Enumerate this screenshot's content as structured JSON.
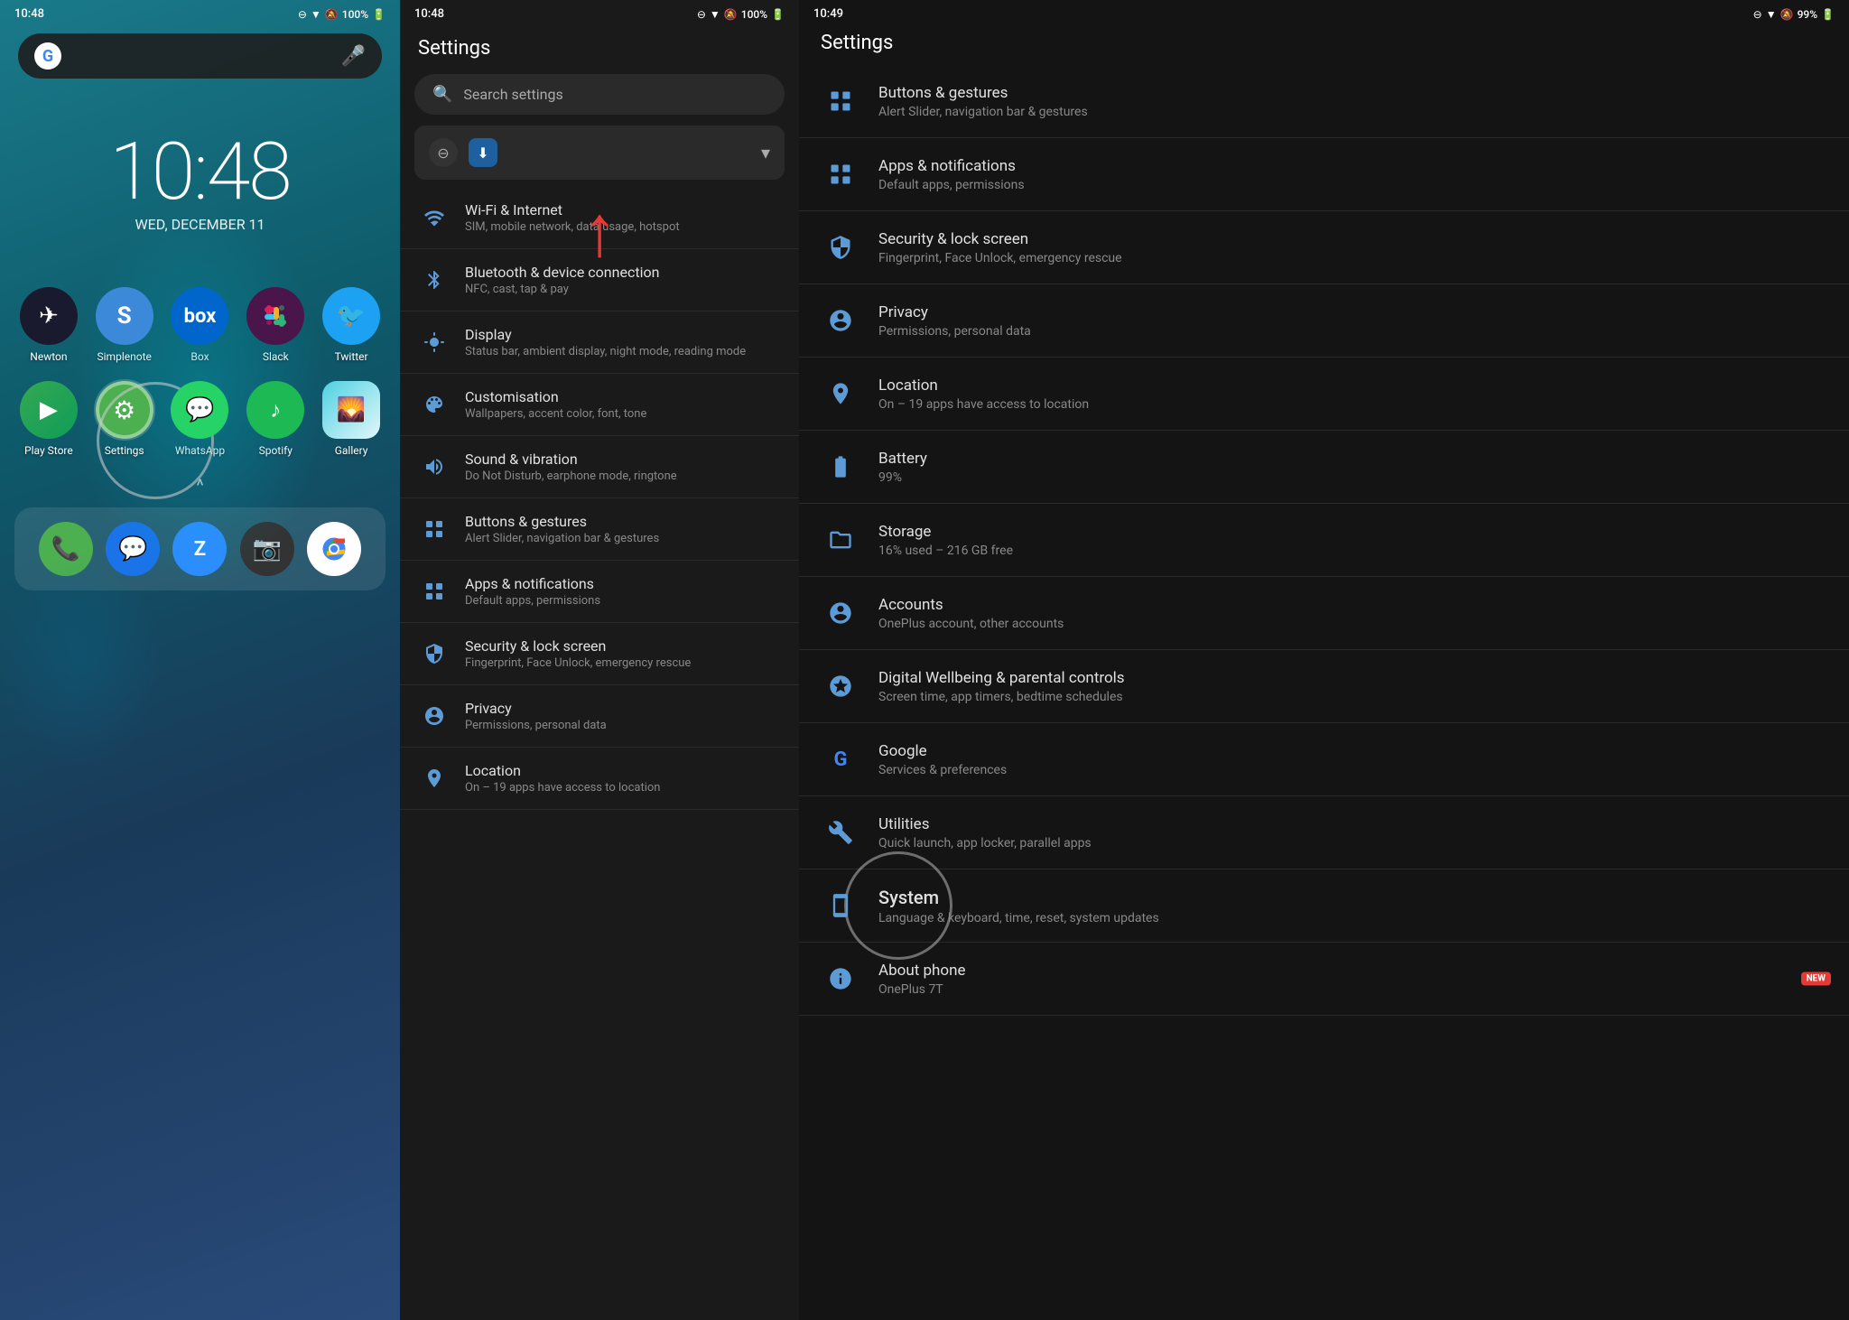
{
  "home": {
    "status": {
      "time": "10:48",
      "battery": "100%"
    },
    "google_bar": {
      "placeholder": "G",
      "mic": "🎤"
    },
    "clock": {
      "time": "10:48",
      "date": "WED, DECEMBER 11"
    },
    "apps_row1": [
      {
        "name": "Newton",
        "label": "Newton",
        "icon": "✈",
        "bg": "#1a1a2e"
      },
      {
        "name": "Simplenote",
        "label": "Simplenote",
        "icon": "S",
        "bg": "#3d89d9"
      },
      {
        "name": "Box",
        "label": "Box",
        "icon": "📦",
        "bg": "#0066cc"
      },
      {
        "name": "Slack",
        "label": "Slack",
        "icon": "#",
        "bg": "#4a154b"
      },
      {
        "name": "Twitter",
        "label": "Twitter",
        "icon": "🐦",
        "bg": "#1da1f2"
      }
    ],
    "apps_row2": [
      {
        "name": "Play Store",
        "label": "Play Store",
        "icon": "▶",
        "bg": "#34a853"
      },
      {
        "name": "Settings",
        "label": "Settings",
        "icon": "⚙",
        "bg": "#4caf50",
        "circled": true
      },
      {
        "name": "WhatsApp",
        "label": "WhatsApp",
        "icon": "💬",
        "bg": "#25d366"
      },
      {
        "name": "Spotify",
        "label": "Spotify",
        "icon": "♪",
        "bg": "#1db954"
      },
      {
        "name": "Gallery",
        "label": "Gallery",
        "icon": "🌈",
        "bg": "#ff6b6b"
      }
    ],
    "swipe_indicator": "^",
    "dock": [
      {
        "name": "Phone",
        "icon": "📞",
        "bg": "#4caf50"
      },
      {
        "name": "Messages",
        "icon": "💬",
        "bg": "#1a73e8"
      },
      {
        "name": "Zoom",
        "icon": "Z",
        "bg": "#2d8cff"
      },
      {
        "name": "Camera",
        "icon": "📷",
        "bg": "#333"
      },
      {
        "name": "Chrome",
        "icon": "◉",
        "bg": "#fff"
      }
    ]
  },
  "settings_middle": {
    "status_time": "10:48",
    "status_battery": "100%",
    "title": "Settings",
    "search_placeholder": "Search settings",
    "items": [
      {
        "title": "Wi-Fi & Internet",
        "subtitle": "SIM, mobile network, data usage, hotspot",
        "icon": "wifi"
      },
      {
        "title": "Bluetooth & device connection",
        "subtitle": "NFC, cast, tap & pay",
        "icon": "bt"
      },
      {
        "title": "Display",
        "subtitle": "Status bar, ambient display, night mode, reading mode",
        "icon": "display"
      },
      {
        "title": "Customisation",
        "subtitle": "Wallpapers, accent color, font, tone",
        "icon": "custom"
      },
      {
        "title": "Sound & vibration",
        "subtitle": "Do Not Disturb, earphone mode, ringtone",
        "icon": "sound"
      },
      {
        "title": "Buttons & gestures",
        "subtitle": "Alert Slider, navigation bar & gestures",
        "icon": "btn"
      },
      {
        "title": "Apps & notifications",
        "subtitle": "Default apps, permissions",
        "icon": "apps"
      },
      {
        "title": "Security & lock screen",
        "subtitle": "Fingerprint, Face Unlock, emergency rescue",
        "icon": "lock"
      },
      {
        "title": "Privacy",
        "subtitle": "Permissions, personal data",
        "icon": "privacy"
      },
      {
        "title": "Location",
        "subtitle": "On – 19 apps have access to location",
        "icon": "location"
      }
    ]
  },
  "settings_right": {
    "status_time": "10:49",
    "status_battery": "99%",
    "title": "Settings",
    "items": [
      {
        "title": "Buttons & gestures",
        "subtitle": "Alert Slider, navigation bar & gestures",
        "icon": "btn"
      },
      {
        "title": "Apps & notifications",
        "subtitle": "Default apps, permissions",
        "icon": "apps"
      },
      {
        "title": "Security & lock screen",
        "subtitle": "Fingerprint, Face Unlock, emergency rescue",
        "icon": "lock"
      },
      {
        "title": "Privacy",
        "subtitle": "Permissions, personal data",
        "icon": "privacy"
      },
      {
        "title": "Location",
        "subtitle": "On – 19 apps have access to location",
        "icon": "location"
      },
      {
        "title": "Battery",
        "subtitle": "99%",
        "icon": "battery"
      },
      {
        "title": "Storage",
        "subtitle": "16% used – 216 GB free",
        "icon": "storage"
      },
      {
        "title": "Accounts",
        "subtitle": "OnePlus account, other accounts",
        "icon": "accounts"
      },
      {
        "title": "Digital Wellbeing & parental controls",
        "subtitle": "Screen time, app timers, bedtime schedules",
        "icon": "digital"
      },
      {
        "title": "Google",
        "subtitle": "Services & preferences",
        "icon": "google"
      },
      {
        "title": "Utilities",
        "subtitle": "Quick launch, app locker, parallel apps",
        "icon": "utilities"
      },
      {
        "title": "System",
        "subtitle": "Language & keyboard, time, reset, system updates",
        "icon": "system",
        "circled": true
      },
      {
        "title": "About phone",
        "subtitle": "OnePlus 7T",
        "icon": "phone_info",
        "badge": "NEW"
      }
    ]
  }
}
